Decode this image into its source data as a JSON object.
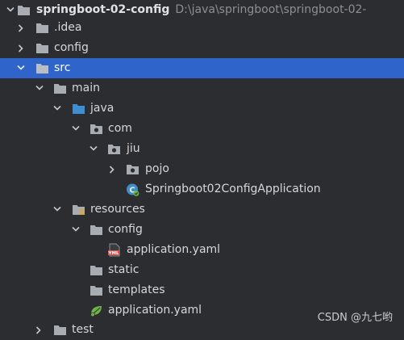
{
  "project_tree": {
    "root": {
      "name": "springboot-02-config",
      "path": "D:\\java\\springboot\\springboot-02-"
    },
    "items": [
      {
        "label": ".idea"
      },
      {
        "label": "config"
      },
      {
        "label": "src"
      },
      {
        "label": "main"
      },
      {
        "label": "java"
      },
      {
        "label": "com"
      },
      {
        "label": "jiu"
      },
      {
        "label": "pojo"
      },
      {
        "label": "Springboot02ConfigApplication"
      },
      {
        "label": "resources"
      },
      {
        "label": "config"
      },
      {
        "label": "application.yaml"
      },
      {
        "label": "static"
      },
      {
        "label": "templates"
      },
      {
        "label": "application.yaml"
      },
      {
        "label": "test"
      }
    ],
    "selected": "src"
  },
  "watermark": "CSDN @九七哟",
  "icons": {
    "folder": "folder-icon",
    "source_folder": "source-folder-icon",
    "package": "package-icon",
    "resources_folder": "resources-folder-icon",
    "spring_class": "spring-boot-class-icon",
    "yaml_file": "yaml-file-icon",
    "spring_yaml": "spring-yaml-icon",
    "chevron_down": "chevron-down-icon",
    "chevron_right": "chevron-right-icon"
  },
  "colors": {
    "background": "#2b2d30",
    "selection": "#2f65ca",
    "folder": "#a8adb4",
    "source_folder": "#3d8fd1",
    "spring_green": "#6fb347",
    "yaml_red": "#d8544f"
  }
}
